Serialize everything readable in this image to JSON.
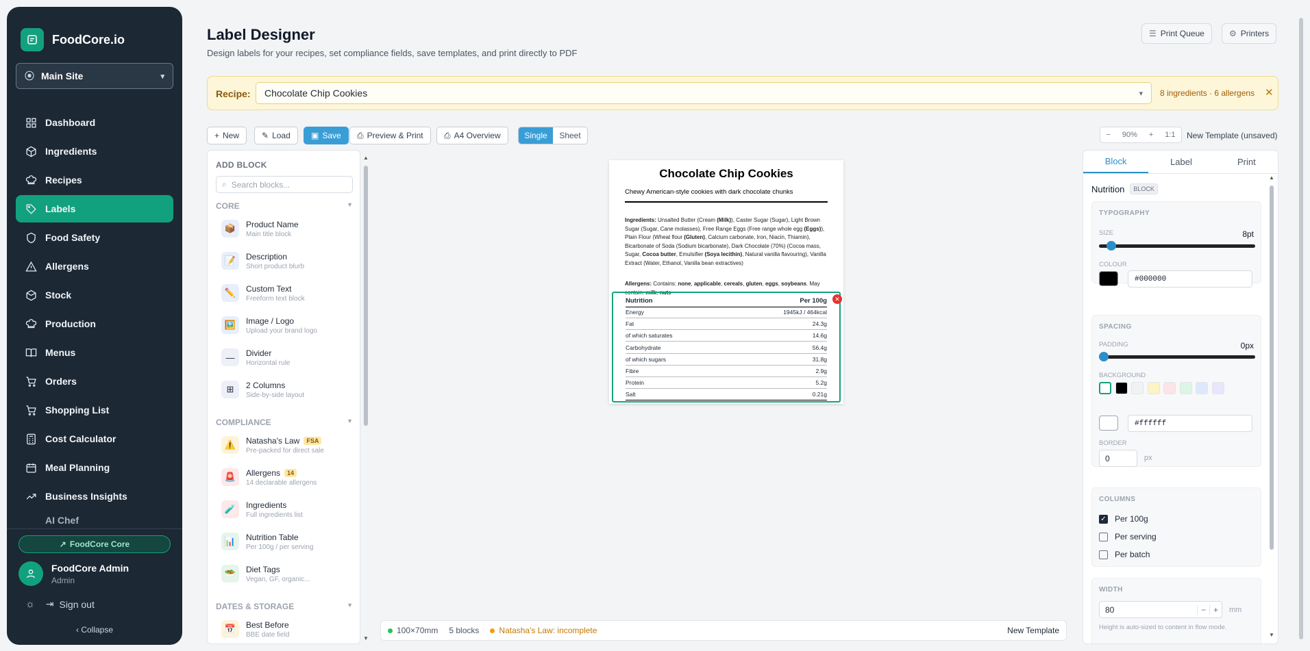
{
  "brand": {
    "name": "FoodCore.io"
  },
  "site_selector": {
    "value": "Main Site"
  },
  "nav": [
    {
      "label": "Dashboard",
      "icon": "grid-icon",
      "active": false
    },
    {
      "label": "Ingredients",
      "icon": "box-icon",
      "active": false
    },
    {
      "label": "Recipes",
      "icon": "chef-hat-icon",
      "active": false
    },
    {
      "label": "Labels",
      "icon": "tag-icon",
      "active": true
    },
    {
      "label": "Food Safety",
      "icon": "shield-icon",
      "active": false
    },
    {
      "label": "Allergens",
      "icon": "warning-icon",
      "active": false
    },
    {
      "label": "Stock",
      "icon": "cube-icon",
      "active": false
    },
    {
      "label": "Production",
      "icon": "chef-hat-icon",
      "active": false
    },
    {
      "label": "Menus",
      "icon": "book-icon",
      "active": false
    },
    {
      "label": "Orders",
      "icon": "cart-icon",
      "active": false
    },
    {
      "label": "Shopping List",
      "icon": "cart-icon",
      "active": false
    },
    {
      "label": "Cost Calculator",
      "icon": "calculator-icon",
      "active": false
    },
    {
      "label": "Meal Planning",
      "icon": "calendar-icon",
      "active": false
    },
    {
      "label": "Business Insights",
      "icon": "trend-icon",
      "active": false
    }
  ],
  "sidebar_footer": {
    "plan_badge": "FoodCore Core",
    "user_name": "FoodCore Admin",
    "user_role": "Admin",
    "sign_out": "Sign out",
    "collapse": "Collapse"
  },
  "header": {
    "title": "Label Designer",
    "subtitle": "Design labels for your recipes, set compliance fields, save templates, and print directly to PDF",
    "print_queue": "Print Queue",
    "printers": "Printers"
  },
  "recipe_bar": {
    "label": "Recipe:",
    "value": "Chocolate Chip Cookies",
    "meta": "8 ingredients · 6 allergens"
  },
  "toolbar": {
    "new": "New",
    "load": "Load",
    "save": "Save",
    "preview": "Preview & Print",
    "a4": "A4 Overview",
    "single": "Single",
    "sheet": "Sheet",
    "zoom_out": "−",
    "zoom": "90%",
    "zoom_in": "+",
    "zoom_reset": "1:1",
    "template_name": "New Template (unsaved)"
  },
  "blocks_panel": {
    "title": "ADD BLOCK",
    "search_placeholder": "Search blocks...",
    "sections": [
      {
        "title": "CORE",
        "items": [
          {
            "name": "Product Name",
            "desc": "Main title block",
            "icon": "📦",
            "bg": "#e8eefb"
          },
          {
            "name": "Description",
            "desc": "Short product blurb",
            "icon": "📝",
            "bg": "#e8eefb"
          },
          {
            "name": "Custom Text",
            "desc": "Freeform text block",
            "icon": "✏️",
            "bg": "#e8eefb"
          },
          {
            "name": "Image / Logo",
            "desc": "Upload your brand logo",
            "icon": "🖼️",
            "bg": "#e8eefb"
          },
          {
            "name": "Divider",
            "desc": "Horizontal rule",
            "icon": "—",
            "bg": "#eef0f8"
          },
          {
            "name": "2 Columns",
            "desc": "Side-by-side layout",
            "icon": "⊞",
            "bg": "#eef0f8"
          }
        ]
      },
      {
        "title": "COMPLIANCE",
        "items": [
          {
            "name": "Natasha's Law",
            "desc": "Pre-packed for direct sale",
            "icon": "⚠️",
            "bg": "#fdf3dc",
            "tag": "FSA"
          },
          {
            "name": "Allergens",
            "desc": "14 declarable allergens",
            "icon": "🚨",
            "bg": "#fde8ea",
            "tag": "14"
          },
          {
            "name": "Ingredients",
            "desc": "Full ingredients list",
            "icon": "🧪",
            "bg": "#fde8ea"
          },
          {
            "name": "Nutrition Table",
            "desc": "Per 100g / per serving",
            "icon": "📊",
            "bg": "#e6f5ec"
          },
          {
            "name": "Diet Tags",
            "desc": "Vegan, GF, organic...",
            "icon": "🥗",
            "bg": "#e6f5ec"
          }
        ]
      },
      {
        "title": "DATES & STORAGE",
        "items": [
          {
            "name": "Best Before",
            "desc": "BBE date field",
            "icon": "📅",
            "bg": "#fdf3dc"
          }
        ]
      }
    ]
  },
  "label": {
    "title": "Chocolate Chip Cookies",
    "description": "Chewy American-style cookies with dark chocolate chunks",
    "ingredients_html": "<b>Ingredients:</b> Unsalted Butter (Cream <b>(Milk)</b>), Caster Sugar (Sugar), Light Brown Sugar (Sugar, Cane molasses), Free Range Eggs (Free range whole egg <b>(Eggs)</b>), Plain Flour (Wheat flour <b>(Gluten)</b>, Calcium carbonate, Iron, Niacin, Thiamin), Bicarbonate of Soda (Sodium bicarbonate), Dark Chocolate (70%) (Cocoa mass, Sugar, <b>Cocoa butter</b>, Emulsifier <b>(Soya lecithin)</b>, Natural vanilla flavouring), Vanilla Extract (Water, Ethanol, Vanilla bean extractives)",
    "allergens_html": "<b>Allergens:</b> Contains: <b>none</b>, <b>applicable</b>, <b>cereals</b>, <b>gluten</b>, <b>eggs</b>, <b>soybeans</b>. May contain: <b>milk</b>, <b>nuts</b>",
    "nutrition": {
      "header": "Nutrition",
      "column": "Per 100g",
      "rows": [
        {
          "name": "Energy",
          "value": "1945kJ / 464kcal"
        },
        {
          "name": "Fat",
          "value": "24.3g"
        },
        {
          "name": "of which saturates",
          "value": "14.6g"
        },
        {
          "name": "Carbohydrate",
          "value": "56.4g"
        },
        {
          "name": "of which sugars",
          "value": "31.8g"
        },
        {
          "name": "Fibre",
          "value": "2.9g"
        },
        {
          "name": "Protein",
          "value": "5.2g"
        },
        {
          "name": "Salt",
          "value": "0.21g"
        }
      ]
    }
  },
  "status_bar": {
    "size": "100×70mm",
    "blocks": "5 blocks",
    "natasha": "Natasha's Law: incomplete",
    "template": "New Template"
  },
  "props": {
    "tabs": [
      "Block",
      "Label",
      "Print"
    ],
    "block_name": "Nutrition",
    "block_badge": "BLOCK",
    "typography": {
      "title": "TYPOGRAPHY",
      "size_label": "SIZE",
      "size_value": "8pt",
      "size_level": 0.05,
      "colour_label": "COLOUR",
      "colour_value": "#000000"
    },
    "spacing": {
      "title": "SPACING",
      "padding_label": "PADDING",
      "padding_value": "0px",
      "padding_level": 0.0,
      "background_label": "BACKGROUND",
      "background_value": "#ffffff",
      "swatches": [
        "#ffffff",
        "#000000",
        "#f1f2f4",
        "#fdf3c4",
        "#fde4e6",
        "#ddf5e4",
        "#dde9fb",
        "#e8e6fb"
      ],
      "border_label": "BORDER",
      "border_value": "0",
      "border_unit": "px"
    },
    "columns": {
      "title": "COLUMNS",
      "options": [
        {
          "label": "Per 100g",
          "checked": true
        },
        {
          "label": "Per serving",
          "checked": false
        },
        {
          "label": "Per batch",
          "checked": false
        }
      ]
    },
    "width": {
      "title": "WIDTH",
      "value": "80",
      "unit": "mm",
      "hint": "Height is auto-sized to content in flow mode."
    }
  },
  "colors": {
    "sidebar": "#1c2834",
    "accent": "#12a17e",
    "primary": "#3a9ed6",
    "recipe_bg": "#fdf6d9"
  }
}
